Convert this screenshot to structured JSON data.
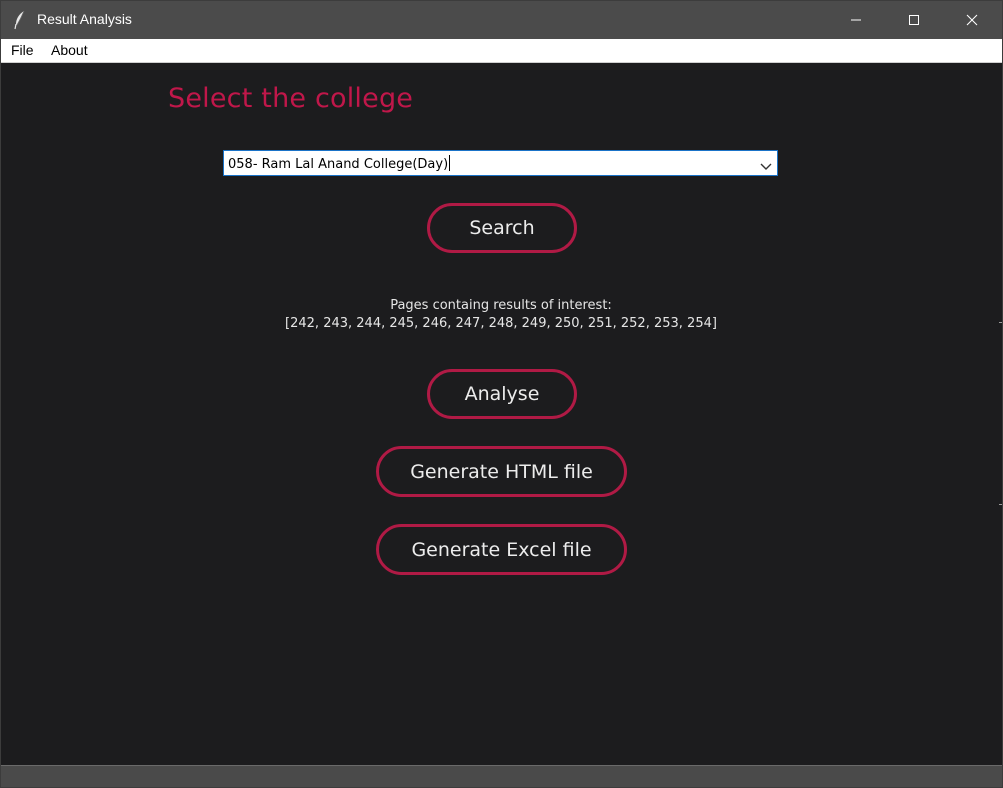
{
  "window": {
    "title": "Result Analysis"
  },
  "menu": {
    "file": "File",
    "about": "About"
  },
  "main": {
    "heading": "Select the college",
    "college_select": {
      "value": "058- Ram Lal Anand College(Day)"
    },
    "search_label": "Search",
    "pages_info": {
      "line1": "Pages containg results of interest:",
      "line2": "[242, 243, 244, 245, 246, 247, 248, 249, 250, 251, 252, 253, 254]"
    },
    "analyse_label": "Analyse",
    "html_label": "Generate HTML file",
    "excel_label": "Generate Excel file"
  },
  "colors": {
    "accent": "#c0174a",
    "button_border": "#b01a45",
    "background": "#1c1c1e",
    "titlebar": "#4b4b4b"
  },
  "icons": {
    "app": "feather-icon",
    "minimize": "minimize-icon",
    "maximize": "maximize-icon",
    "close": "close-icon",
    "dropdown": "chevron-down-icon"
  }
}
